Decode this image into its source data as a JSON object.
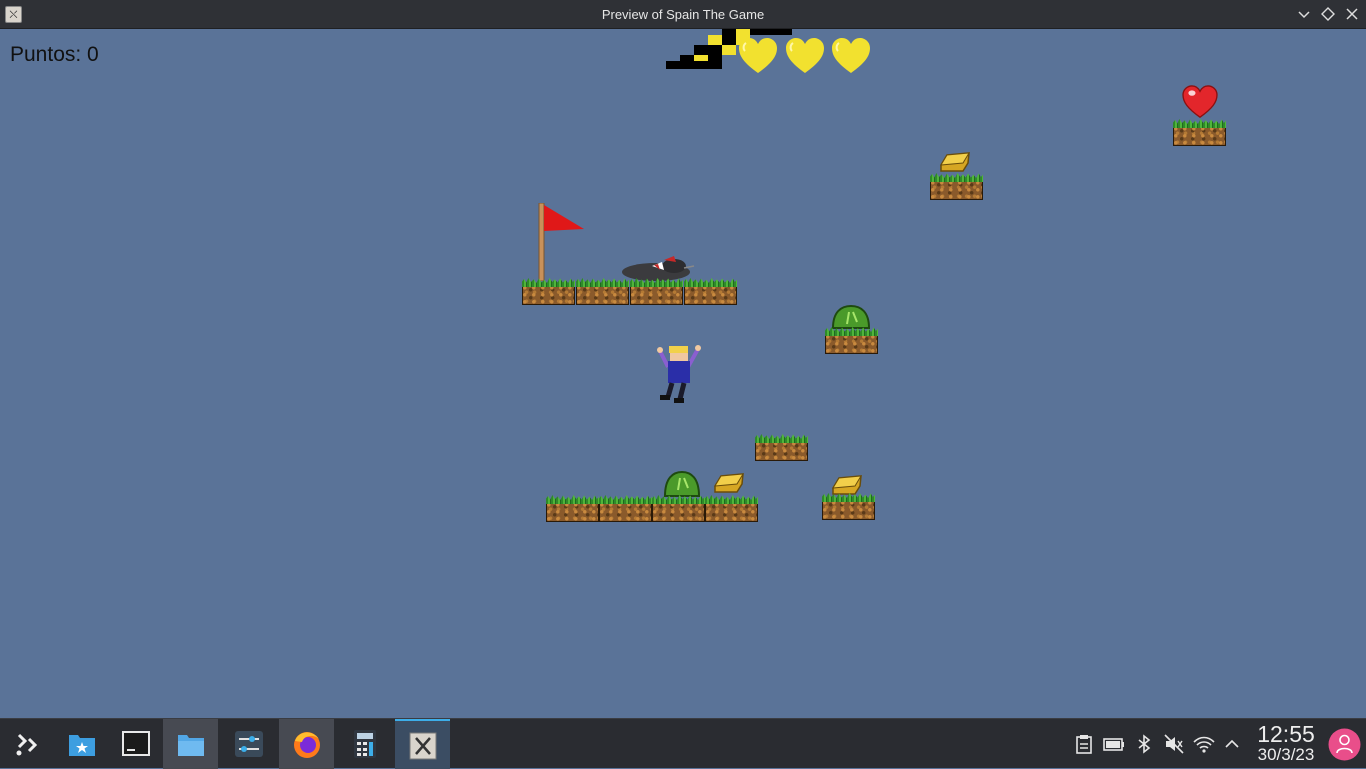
{
  "window": {
    "title": "Preview of Spain The Game"
  },
  "hud": {
    "score_text": "Puntos: 0",
    "lives": 3
  },
  "taskbar": {
    "apps": [
      "application-launcher",
      "discover",
      "terminal",
      "file-manager",
      "system-settings",
      "firefox",
      "calculator",
      "spain-the-game"
    ],
    "clock_time": "12:55",
    "clock_date": "30/3/23"
  },
  "colors": {
    "sky": "#5a7398",
    "panel": "#2a2c31",
    "accent": "#3daee9",
    "life_heart": "#f2e12f",
    "flag": "#e01818"
  }
}
